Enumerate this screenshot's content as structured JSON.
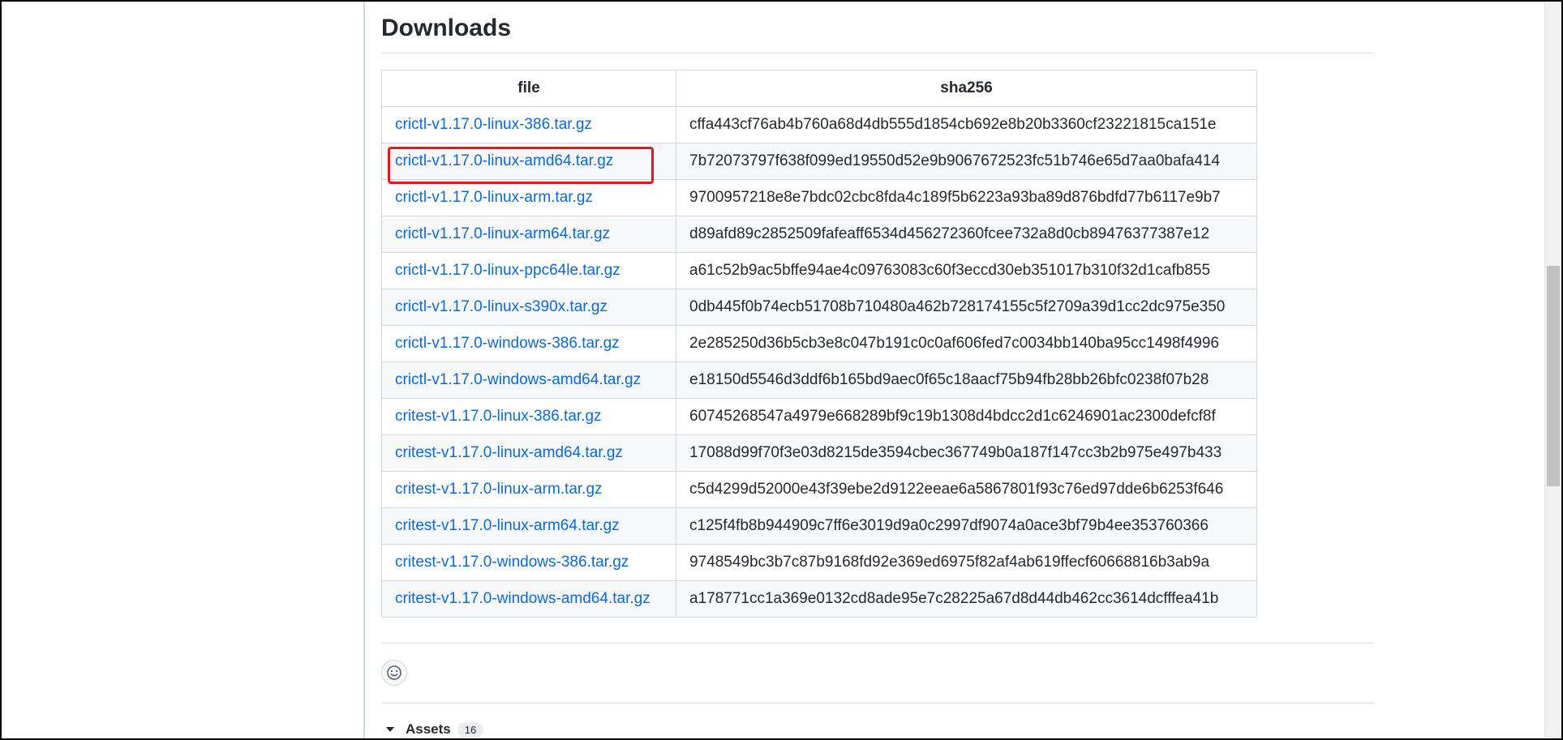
{
  "section": {
    "title": "Downloads"
  },
  "table": {
    "headers": {
      "file": "file",
      "sha": "sha256"
    },
    "rows": [
      {
        "file": "crictl-v1.17.0-linux-386.tar.gz",
        "sha": "cffa443cf76ab4b760a68d4db555d1854cb692e8b20b3360cf23221815ca151e"
      },
      {
        "file": "crictl-v1.17.0-linux-amd64.tar.gz",
        "sha": "7b72073797f638f099ed19550d52e9b9067672523fc51b746e65d7aa0bafa414"
      },
      {
        "file": "crictl-v1.17.0-linux-arm.tar.gz",
        "sha": "9700957218e8e7bdc02cbc8fda4c189f5b6223a93ba89d876bdfd77b6117e9b7"
      },
      {
        "file": "crictl-v1.17.0-linux-arm64.tar.gz",
        "sha": "d89afd89c2852509fafeaff6534d456272360fcee732a8d0cb89476377387e12"
      },
      {
        "file": "crictl-v1.17.0-linux-ppc64le.tar.gz",
        "sha": "a61c52b9ac5bffe94ae4c09763083c60f3eccd30eb351017b310f32d1cafb855"
      },
      {
        "file": "crictl-v1.17.0-linux-s390x.tar.gz",
        "sha": "0db445f0b74ecb51708b710480a462b728174155c5f2709a39d1cc2dc975e350"
      },
      {
        "file": "crictl-v1.17.0-windows-386.tar.gz",
        "sha": "2e285250d36b5cb3e8c047b191c0c0af606fed7c0034bb140ba95cc1498f4996"
      },
      {
        "file": "crictl-v1.17.0-windows-amd64.tar.gz",
        "sha": "e18150d5546d3ddf6b165bd9aec0f65c18aacf75b94fb28bb26bfc0238f07b28"
      },
      {
        "file": "critest-v1.17.0-linux-386.tar.gz",
        "sha": "60745268547a4979e668289bf9c19b1308d4bdcc2d1c6246901ac2300defcf8f"
      },
      {
        "file": "critest-v1.17.0-linux-amd64.tar.gz",
        "sha": "17088d99f70f3e03d8215de3594cbec367749b0a187f147cc3b2b975e497b433"
      },
      {
        "file": "critest-v1.17.0-linux-arm.tar.gz",
        "sha": "c5d4299d52000e43f39ebe2d9122eeae6a5867801f93c76ed97dde6b6253f646"
      },
      {
        "file": "critest-v1.17.0-linux-arm64.tar.gz",
        "sha": "c125f4fb8b944909c7ff6e3019d9a0c2997df9074a0ace3bf79b4ee353760366"
      },
      {
        "file": "critest-v1.17.0-windows-386.tar.gz",
        "sha": "9748549bc3b7c87b9168fd92e369ed6975f82af4ab619ffecf60668816b3ab9a"
      },
      {
        "file": "critest-v1.17.0-windows-amd64.tar.gz",
        "sha": "a178771cc1a369e0132cd8ade95e7c28225a67d8d44db462cc3614dcfffea41b"
      }
    ]
  },
  "reaction": {
    "icon": "smiley-icon"
  },
  "assets": {
    "label": "Assets",
    "count": "16",
    "icon": "triangle-down-icon"
  },
  "colors": {
    "link": "#0969da",
    "highlight": "#e8161b",
    "text": "#24292f",
    "border": "#d0d7de",
    "stripe": "#f6f8fa"
  }
}
